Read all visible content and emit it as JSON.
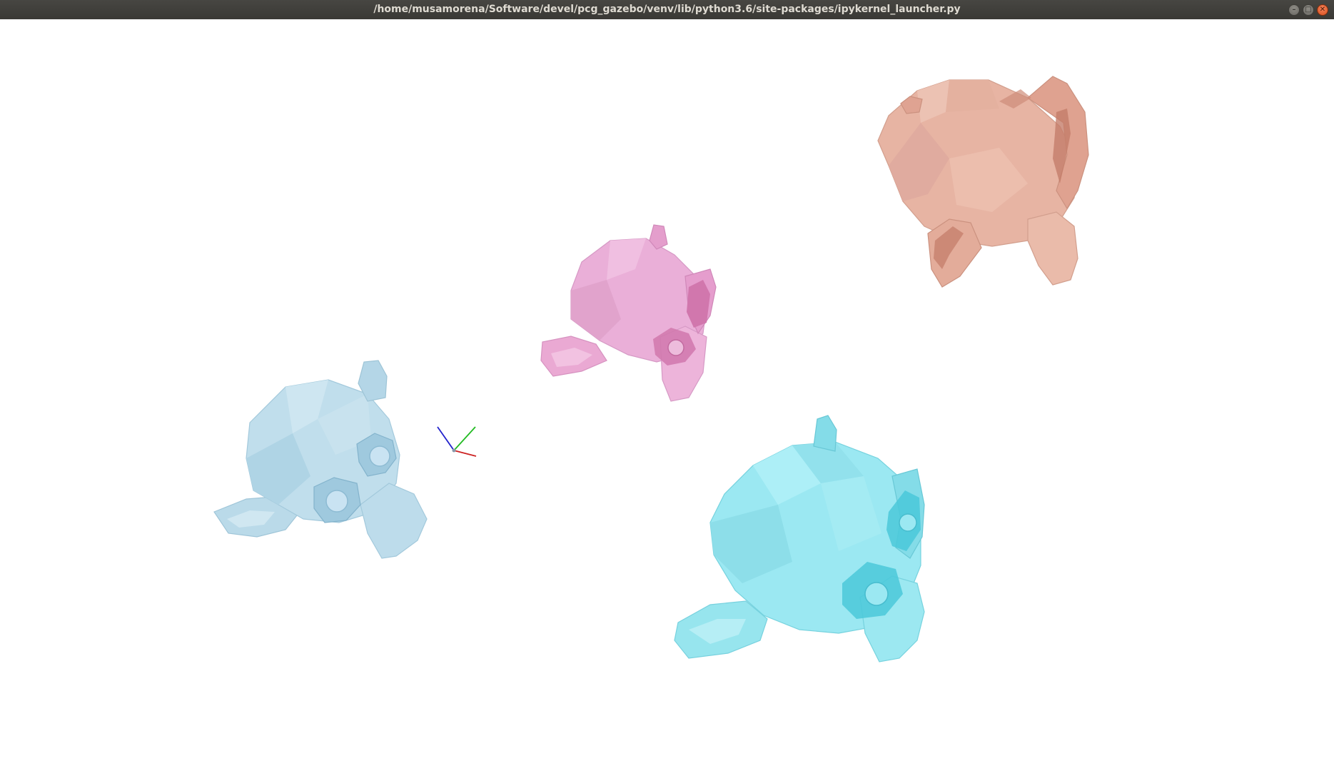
{
  "window": {
    "title": "/home/musamorena/Software/devel/pcg_gazebo/venv/lib/python3.6/site-packages/ipykernel_launcher.py",
    "controls": {
      "minimize_icon": "minimize-icon",
      "maximize_icon": "maximize-icon",
      "close_icon": "close-icon"
    }
  },
  "scene": {
    "background": "#ffffff",
    "objects": [
      {
        "name": "light-blue-monkey-mesh",
        "color": "#a8d2e4"
      },
      {
        "name": "pink-monkey-mesh",
        "color": "#e596c9"
      },
      {
        "name": "salmon-monkey-mesh",
        "color": "#e8a58f"
      },
      {
        "name": "cyan-monkey-mesh",
        "color": "#7fe0ec"
      }
    ],
    "axes": {
      "x_color": "#d02020",
      "y_color": "#20c020",
      "z_color": "#2020d0"
    }
  }
}
